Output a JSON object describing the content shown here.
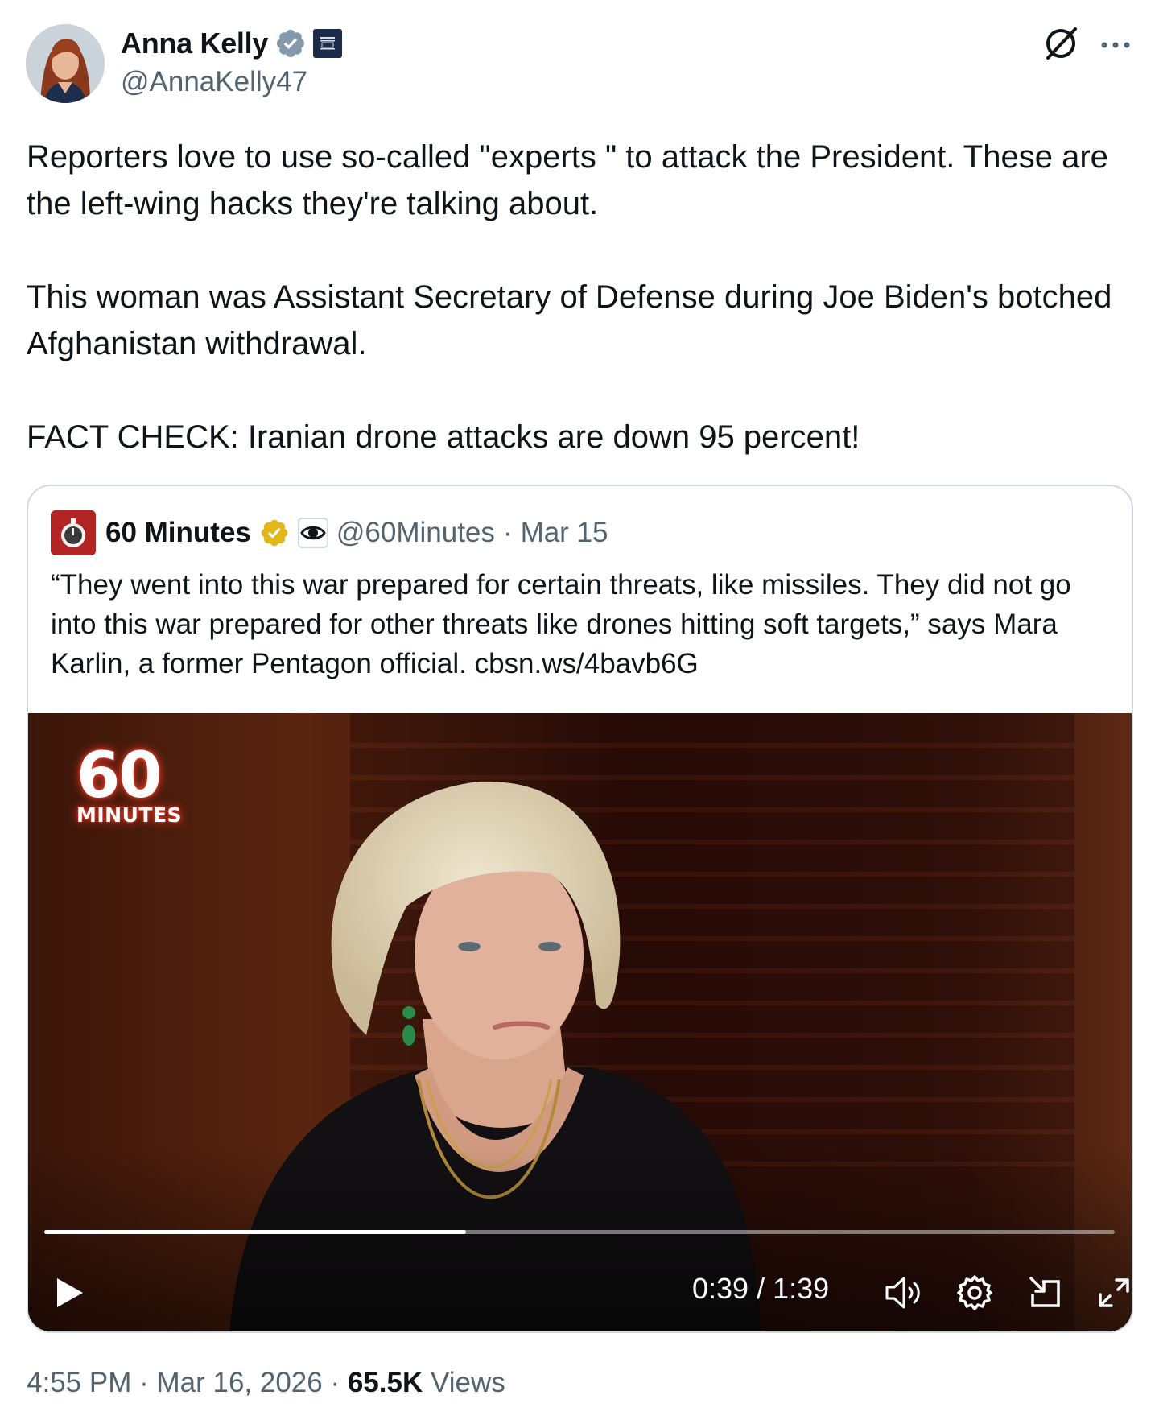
{
  "author": {
    "display_name": "Anna Kelly",
    "handle": "@AnnaKelly47",
    "verified_icon": "verified-badge-icon",
    "affiliation_icon": "white-house-badge-icon"
  },
  "post": {
    "paragraphs": [
      "Reporters love to use so-called \"experts \" to attack the President. These are the left-wing hacks they're talking about.",
      "This woman was Assistant Secretary of Defense during Joe Biden's botched Afghanistan withdrawal.",
      "FACT CHECK: Iranian drone attacks are down 95 percent!"
    ]
  },
  "quote": {
    "display_name": "60 Minutes",
    "handle": "@60Minutes",
    "separator": "·",
    "date": "Mar 15",
    "text": "“They went into this war prepared for certain threats, like missiles. They did not go into this war prepared for other threats like drones hitting soft targets,” says Mara Karlin, a former Pentagon official. cbsn.ws/4bavb6G",
    "video": {
      "logo_number": "60",
      "logo_word": "MINUTES",
      "elapsed": "0:39",
      "duration": "1:39",
      "time_display": "0:39 / 1:39",
      "progress_fraction": 0.394
    }
  },
  "footer": {
    "time": "4:55 PM",
    "separator": "·",
    "date": "Mar 16, 2026",
    "views_count": "65.5K",
    "views_label": "Views"
  },
  "colors": {
    "text_primary": "#0f1419",
    "text_secondary": "#536471",
    "border": "#cfd9de",
    "verified_blue": "#829aab",
    "gold_check": "#e2b719"
  }
}
